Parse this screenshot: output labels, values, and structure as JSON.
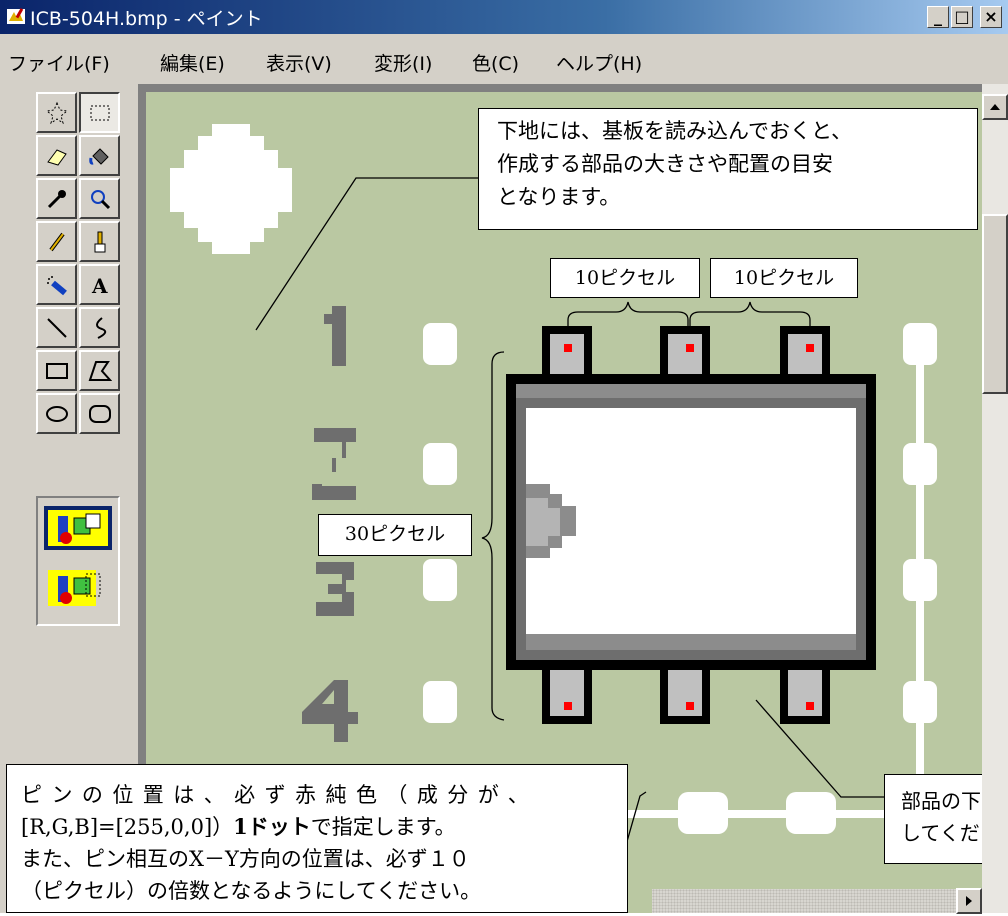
{
  "window": {
    "title": "ICB-504H.bmp - ペイント",
    "controls": {
      "minimize": "_",
      "maximize": "□",
      "close": "×"
    }
  },
  "menu": {
    "items": [
      "ファイル(F)",
      "編集(E)",
      "表示(V)",
      "変形(I)",
      "色(C)",
      "ヘルプ(H)"
    ]
  },
  "tools": [
    "free-select",
    "rect-select",
    "eraser",
    "fill",
    "color-picker",
    "magnifier",
    "pencil",
    "brush",
    "airbrush",
    "text",
    "line",
    "curve",
    "rectangle",
    "polygon",
    "ellipse",
    "rounded-rectangle"
  ],
  "pin_labels": [
    "1",
    "2",
    "3",
    "4"
  ],
  "annotations": {
    "top_note": [
      "下地には、基板を読み込んでおくと、",
      "作成する部品の大きさや配置の目安",
      "となります。"
    ],
    "pitch_left": "10ピクセル",
    "pitch_right": "10ピクセル",
    "height_label": "30ピクセル",
    "bottom_note": {
      "line1": "ピンの位置は、必ず赤純色（成分が、",
      "line2_pre": "[R,G,B]=[255,0,0]）",
      "line2_bold": "1ドット",
      "line2_post": "で指定します。",
      "line3": "また、ピン相互のX－Y方向の位置は、必ず１０",
      "line4": "（ピクセル）の倍数となるようにしてください。"
    },
    "right_note": [
      "部品の下",
      "してくだ"
    ]
  },
  "colors": {
    "board": "#bac8a2",
    "pin_marker": "#ff0000",
    "title_start": "#0a246a",
    "title_end": "#a6caf0"
  }
}
